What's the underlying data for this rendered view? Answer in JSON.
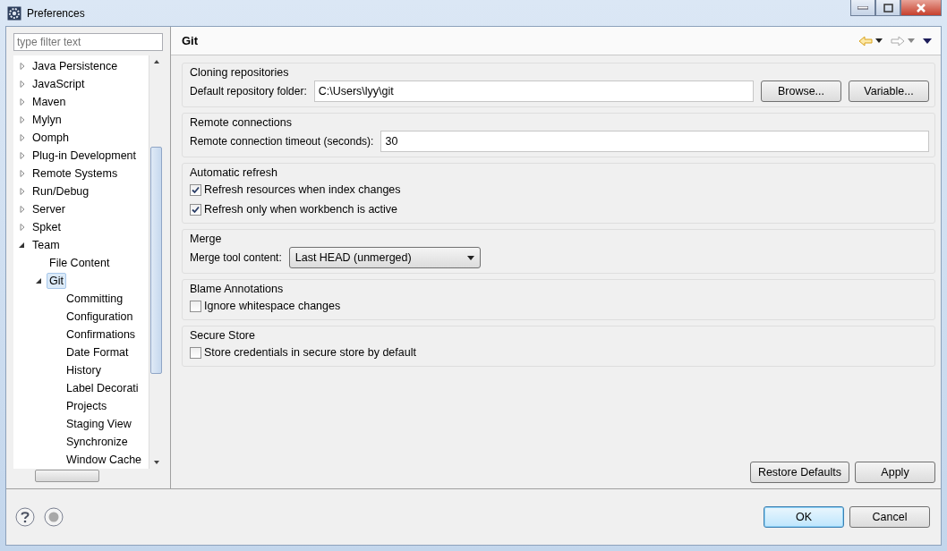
{
  "window": {
    "title": "Preferences"
  },
  "filter": {
    "placeholder": "type filter text"
  },
  "tree": [
    {
      "label": "Java Persistence",
      "expanded": false,
      "selected": false
    },
    {
      "label": "JavaScript",
      "expanded": false,
      "selected": false
    },
    {
      "label": "Maven",
      "expanded": false,
      "selected": false
    },
    {
      "label": "Mylyn",
      "expanded": false,
      "selected": false
    },
    {
      "label": "Oomph",
      "expanded": false,
      "selected": false
    },
    {
      "label": "Plug-in Development",
      "expanded": false,
      "selected": false
    },
    {
      "label": "Remote Systems",
      "expanded": false,
      "selected": false
    },
    {
      "label": "Run/Debug",
      "expanded": false,
      "selected": false
    },
    {
      "label": "Server",
      "expanded": false,
      "selected": false
    },
    {
      "label": "Spket",
      "expanded": false,
      "selected": false
    },
    {
      "label": "Team",
      "expanded": true,
      "selected": false,
      "children": [
        {
          "label": "File Content",
          "selected": false
        },
        {
          "label": "Git",
          "expanded": true,
          "selected": true,
          "children": [
            {
              "label": "Committing",
              "selected": false
            },
            {
              "label": "Configuration",
              "selected": false
            },
            {
              "label": "Confirmations",
              "selected": false
            },
            {
              "label": "Date Format",
              "selected": false
            },
            {
              "label": "History",
              "selected": false
            },
            {
              "label": "Label Decorati",
              "selected": false
            },
            {
              "label": "Projects",
              "selected": false
            },
            {
              "label": "Staging View",
              "selected": false
            },
            {
              "label": "Synchronize",
              "selected": false
            },
            {
              "label": "Window Cache",
              "selected": false
            }
          ]
        }
      ]
    }
  ],
  "page": {
    "title": "Git",
    "sections": [
      {
        "title": "Cloning repositories",
        "rows": [
          {
            "kind": "field",
            "label": "Default repository folder:",
            "value": "C:\\Users\\lyy\\git",
            "buttons": [
              "Browse...",
              "Variable..."
            ]
          }
        ]
      },
      {
        "title": "Remote connections",
        "rows": [
          {
            "kind": "field",
            "label": "Remote connection timeout (seconds):",
            "value": "30",
            "buttons": []
          }
        ]
      },
      {
        "title": "Automatic refresh",
        "rows": [
          {
            "kind": "checkbox",
            "label": "Refresh resources when index changes",
            "checked": true
          },
          {
            "kind": "checkbox",
            "label": "Refresh only when workbench is active",
            "checked": true
          }
        ]
      },
      {
        "title": "Merge",
        "rows": [
          {
            "kind": "select",
            "label": "Merge tool content:",
            "value": "Last HEAD (unmerged)"
          }
        ]
      },
      {
        "title": "Blame Annotations",
        "rows": [
          {
            "kind": "checkbox",
            "label": "Ignore whitespace changes",
            "checked": false
          }
        ]
      },
      {
        "title": "Secure Store",
        "rows": [
          {
            "kind": "checkbox",
            "label": "Store credentials in secure store by default",
            "checked": false
          }
        ]
      }
    ],
    "page_buttons": [
      "Restore Defaults",
      "Apply"
    ]
  },
  "dialog_buttons": [
    {
      "label": "OK",
      "default": true
    },
    {
      "label": "Cancel",
      "default": false
    }
  ]
}
